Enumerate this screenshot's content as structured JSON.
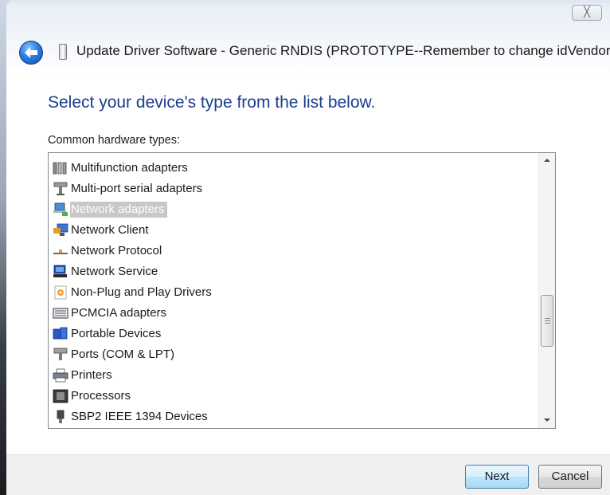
{
  "window": {
    "title": "Update Driver Software - Generic RNDIS (PROTOTYPE--Remember to change idVendor)",
    "close_glyph": "╳"
  },
  "heading": "Select your device's type from the list below.",
  "list_caption": "Common hardware types:",
  "hardware_types": [
    {
      "label": "Multifunction adapters",
      "icon": "multifunction-icon",
      "selected": false
    },
    {
      "label": "Multi-port serial adapters",
      "icon": "serial-port-icon",
      "selected": false
    },
    {
      "label": "Network adapters",
      "icon": "network-adapter-icon",
      "selected": true
    },
    {
      "label": "Network Client",
      "icon": "network-client-icon",
      "selected": false
    },
    {
      "label": "Network Protocol",
      "icon": "network-protocol-icon",
      "selected": false
    },
    {
      "label": "Network Service",
      "icon": "network-service-icon",
      "selected": false
    },
    {
      "label": "Non-Plug and Play Drivers",
      "icon": "non-pnp-driver-icon",
      "selected": false
    },
    {
      "label": "PCMCIA adapters",
      "icon": "pcmcia-icon",
      "selected": false
    },
    {
      "label": "Portable Devices",
      "icon": "portable-device-icon",
      "selected": false
    },
    {
      "label": "Ports (COM & LPT)",
      "icon": "port-icon",
      "selected": false
    },
    {
      "label": "Printers",
      "icon": "printer-icon",
      "selected": false
    },
    {
      "label": "Processors",
      "icon": "processor-icon",
      "selected": false
    },
    {
      "label": "SBP2 IEEE 1394 Devices",
      "icon": "ieee1394-icon",
      "selected": false
    }
  ],
  "buttons": {
    "next": "Next",
    "cancel": "Cancel"
  },
  "colors": {
    "heading": "#1a3d8f",
    "selection": "#c8c8c8"
  }
}
